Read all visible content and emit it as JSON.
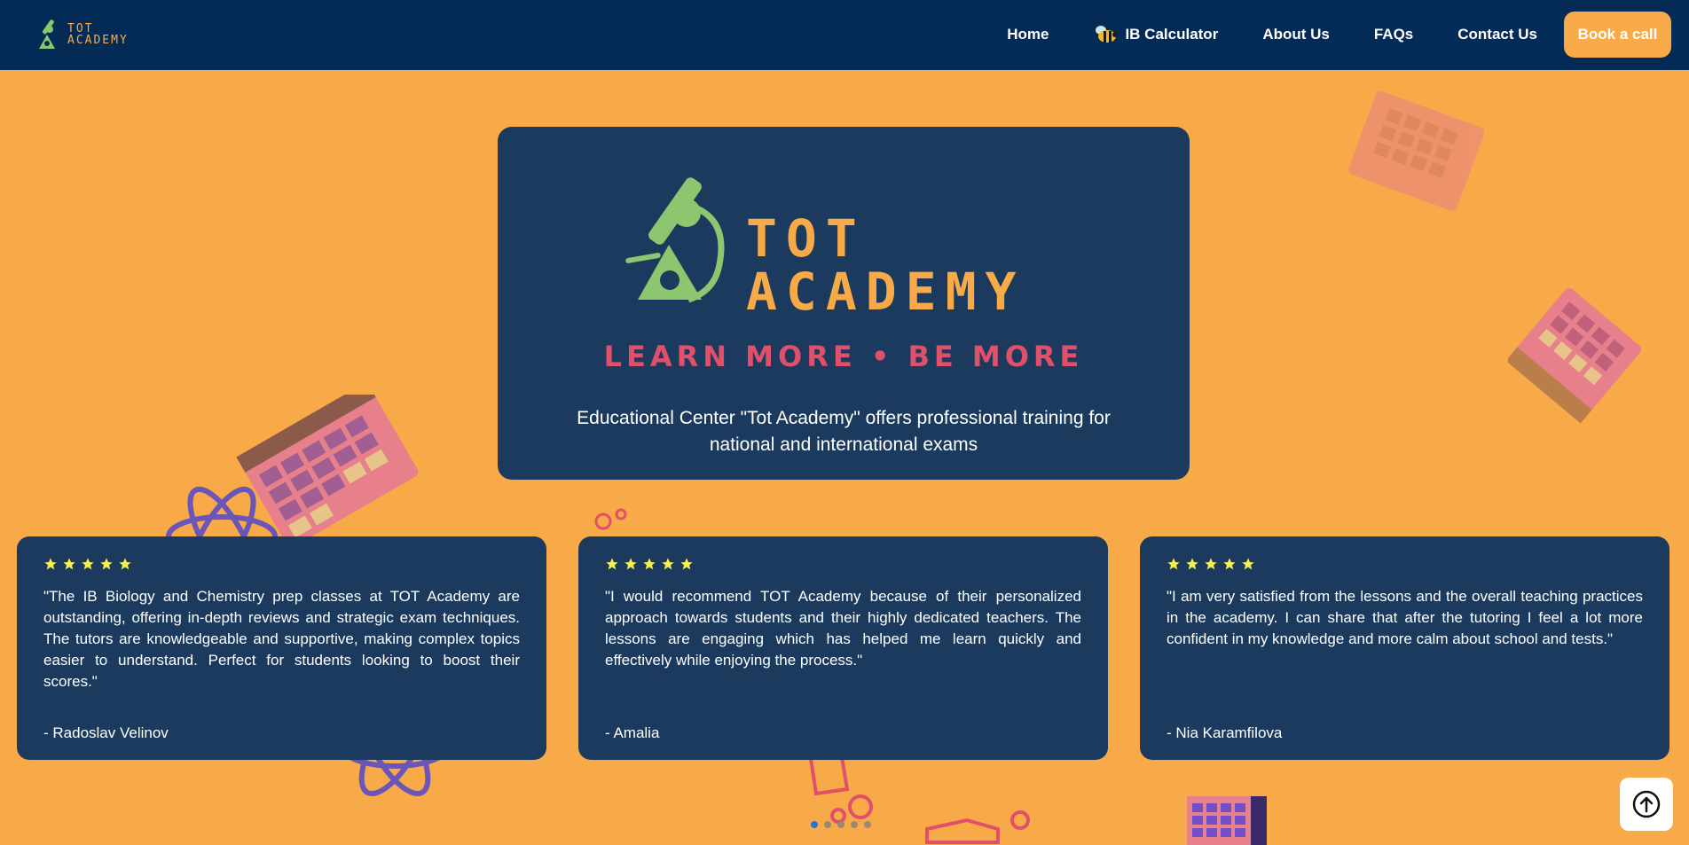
{
  "header": {
    "logo": {
      "line1": "TOT",
      "line2": "ACADEMY"
    },
    "nav": [
      {
        "label": "Home"
      },
      {
        "label": "IB Calculator",
        "icon": "bee-icon"
      },
      {
        "label": "About Us"
      },
      {
        "label": "FAQs"
      },
      {
        "label": "Contact Us"
      }
    ],
    "cta_label": "Book a call"
  },
  "hero": {
    "logo_line1": "TOT",
    "logo_line2": "ACADEMY",
    "tagline": "LEARN MORE • BE MORE",
    "description": "Educational Center \"Tot Academy\" offers professional training for national and international exams"
  },
  "testimonials": [
    {
      "rating": 5,
      "quote": "\"The IB Biology and Chemistry prep classes at TOT Academy are outstanding, offering in-depth reviews and strategic exam techniques. The tutors are knowledgeable and supportive, making complex topics easier to understand. Perfect for students looking to boost their scores.\"",
      "author": "- Radoslav Velinov"
    },
    {
      "rating": 5,
      "quote": "\"I would recommend TOT Academy because of their personalized approach towards students and their highly dedicated teachers. The lessons are engaging which has helped me learn quickly and effectively while enjoying the process.\"",
      "author": "- Amalia"
    },
    {
      "rating": 5,
      "quote": "\"I am very satisfied from the lessons and the overall teaching practices in the academy. I can share that after the tutoring I feel a lot more confident in my knowledge and more calm about school and tests.\"",
      "author": "- Nia Karamfilova"
    }
  ],
  "carousel": {
    "pages": 5,
    "active": 0
  },
  "colors": {
    "header_bg": "#042B56",
    "page_bg": "#F8AA48",
    "card_bg": "#1B3A5E",
    "accent_orange": "#F8AA48",
    "logo_green": "#8CC66E",
    "tagline_red": "#E0506A",
    "star_yellow": "#F5F050"
  }
}
